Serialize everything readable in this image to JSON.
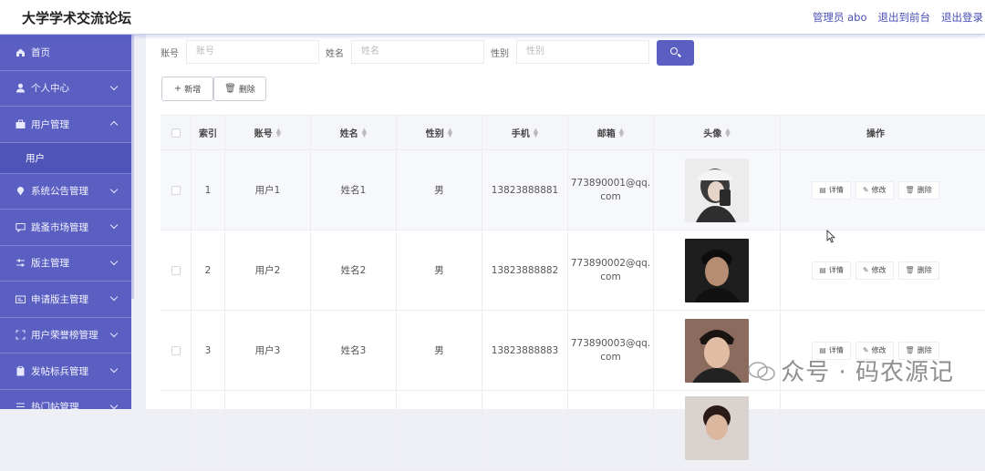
{
  "header": {
    "title": "大学学术交流论坛",
    "links": [
      "管理员 abo",
      "退出到前台",
      "退出登录"
    ]
  },
  "sidebar": {
    "items": [
      {
        "label": "首页",
        "icon": "home-icon",
        "chevron": ""
      },
      {
        "label": "个人中心",
        "icon": "user-icon",
        "chevron": "down"
      },
      {
        "label": "用户管理",
        "icon": "briefcase-icon",
        "chevron": "up"
      },
      {
        "label": "系统公告管理",
        "icon": "location-icon",
        "chevron": "down"
      },
      {
        "label": "跳蚤市场管理",
        "icon": "chat-icon",
        "chevron": "down"
      },
      {
        "label": "版主管理",
        "icon": "sliders-icon",
        "chevron": "down"
      },
      {
        "label": "申请版主管理",
        "icon": "card-icon",
        "chevron": "down"
      },
      {
        "label": "用户荣誉榜管理",
        "icon": "frame-icon",
        "chevron": "down"
      },
      {
        "label": "发帖标兵管理",
        "icon": "clipboard-icon",
        "chevron": "down"
      },
      {
        "label": "热门帖管理",
        "icon": "list-icon",
        "chevron": "down"
      }
    ],
    "submenu_label": "用户"
  },
  "search": {
    "account_label": "账号",
    "account_placeholder": "账号",
    "name_label": "姓名",
    "name_placeholder": "姓名",
    "gender_label": "性别",
    "gender_placeholder": "性别"
  },
  "actions": {
    "add_label": "新增",
    "delete_label": "删除"
  },
  "table": {
    "columns": [
      "索引",
      "账号",
      "姓名",
      "性别",
      "手机",
      "邮箱",
      "头像",
      "操作"
    ],
    "rows": [
      {
        "index": "1",
        "account": "用户1",
        "name": "姓名1",
        "gender": "男",
        "phone": "13823888881",
        "email_line1": "773890001@qq.",
        "email_line2": "com"
      },
      {
        "index": "2",
        "account": "用户2",
        "name": "姓名2",
        "gender": "男",
        "phone": "13823888882",
        "email_line1": "773890002@qq.",
        "email_line2": "com"
      },
      {
        "index": "3",
        "account": "用户3",
        "name": "姓名3",
        "gender": "男",
        "phone": "13823888883",
        "email_line1": "773890003@qq.",
        "email_line2": "com"
      }
    ],
    "op_labels": {
      "detail": "详情",
      "edit": "修改",
      "delete": "删除"
    }
  },
  "watermark": "众号 · 码农源记",
  "colors": {
    "primary": "#5a5fc1",
    "sidebar_divider": "#7d82d4",
    "header_link": "#4a4fb8"
  }
}
